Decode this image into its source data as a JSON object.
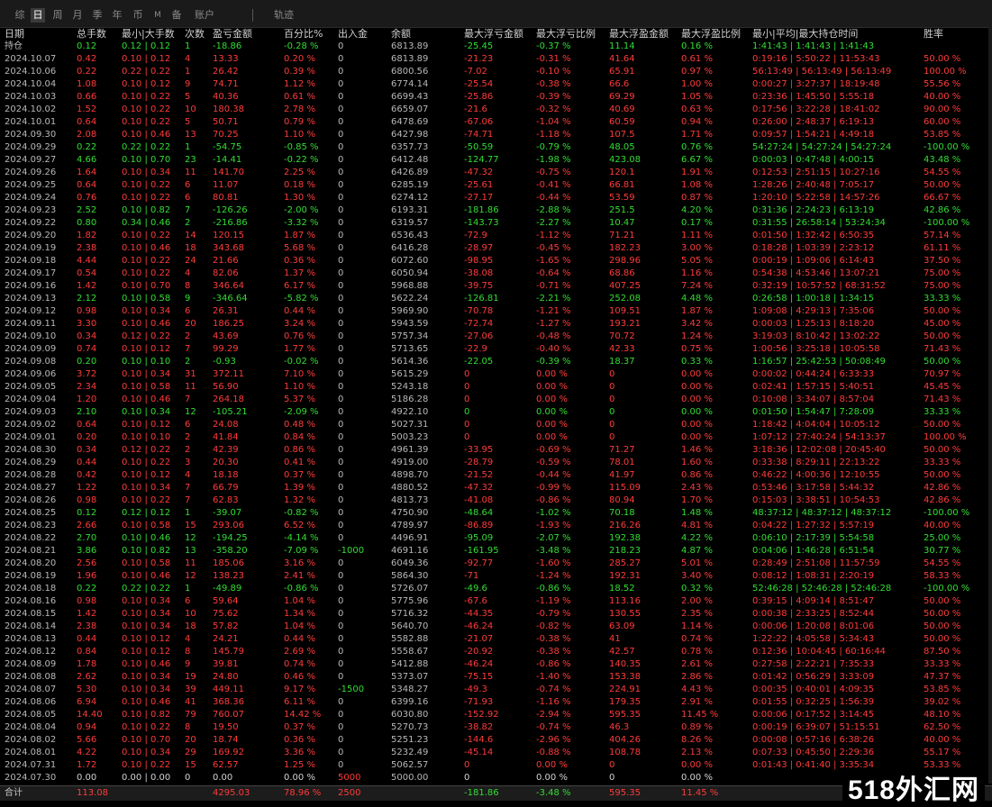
{
  "tabs": [
    {
      "label": "综",
      "active": false,
      "small": false
    },
    {
      "label": "日",
      "active": true,
      "small": false
    },
    {
      "label": "周",
      "active": false,
      "small": false
    },
    {
      "label": "月",
      "active": false,
      "small": false
    },
    {
      "label": "季",
      "active": false,
      "small": false
    },
    {
      "label": "年",
      "active": false,
      "small": false
    },
    {
      "label": "币",
      "active": false,
      "small": false
    },
    {
      "label": "M",
      "active": false,
      "small": true
    },
    {
      "label": "备",
      "active": false,
      "small": false
    },
    {
      "label": "账户",
      "active": false,
      "small": false
    },
    {
      "label": "轨迹",
      "active": false,
      "small": false
    }
  ],
  "columns": [
    "日期",
    "总手数",
    "最小|大手数",
    "次数",
    "盈亏金额",
    "百分比%",
    "出入金",
    "余额",
    "最大浮亏金额",
    "最大浮亏比例",
    "最大浮盈金额",
    "最大浮盈比例",
    "最小|平均|最大持仓时间",
    "胜率"
  ],
  "holding": [
    "持仓",
    "0.12",
    "0.12 | 0.12",
    "1",
    "-18.86",
    "-0.28 %",
    "0",
    "6813.89",
    "-25.45",
    "-0.37 %",
    "11.14",
    "0.16 %",
    "1:41:43 | 1:41:43 | 1:41:43",
    ""
  ],
  "rows": [
    [
      "2024.10.07",
      "0.42",
      "0.10 | 0.12",
      "4",
      "13.33",
      "0.20 %",
      "0",
      "6813.89",
      "-21.23",
      "-0.31 %",
      "41.64",
      "0.61 %",
      "0:19:16 | 5:50:22 | 11:53:43",
      "50.00 %"
    ],
    [
      "2024.10.06",
      "0.22",
      "0.22 | 0.22",
      "1",
      "26.42",
      "0.39 %",
      "0",
      "6800.56",
      "-7.02",
      "-0.10 %",
      "65.91",
      "0.97 %",
      "56:13:49 | 56:13:49 | 56:13:49",
      "100.00 %"
    ],
    [
      "2024.10.04",
      "1.08",
      "0.10 | 0.12",
      "9",
      "74.71",
      "1.12 %",
      "0",
      "6774.14",
      "-25.54",
      "-0.38 %",
      "66.6",
      "1.00 %",
      "0:00:27 | 3:27:37 | 18:19:48",
      "55.56 %"
    ],
    [
      "2024.10.03",
      "0.66",
      "0.10 | 0.22",
      "5",
      "40.36",
      "0.61 %",
      "0",
      "6699.43",
      "-25.86",
      "-0.39 %",
      "69.29",
      "1.05 %",
      "0:23:36 | 1:45:50 | 5:55:18",
      "40.00 %"
    ],
    [
      "2024.10.02",
      "1.52",
      "0.10 | 0.22",
      "10",
      "180.38",
      "2.78 %",
      "0",
      "6659.07",
      "-21.6",
      "-0.32 %",
      "40.69",
      "0.63 %",
      "0:17:56 | 3:22:28 | 18:41:02",
      "90.00 %"
    ],
    [
      "2024.10.01",
      "0.64",
      "0.10 | 0.22",
      "5",
      "50.71",
      "0.79 %",
      "0",
      "6478.69",
      "-67.06",
      "-1.04 %",
      "60.59",
      "0.94 %",
      "0:26:00 | 2:48:37 | 6:19:13",
      "60.00 %"
    ],
    [
      "2024.09.30",
      "2.08",
      "0.10 | 0.46",
      "13",
      "70.25",
      "1.10 %",
      "0",
      "6427.98",
      "-74.71",
      "-1.18 %",
      "107.5",
      "1.71 %",
      "0:09:57 | 1:54:21 | 4:49:18",
      "53.85 %"
    ],
    [
      "2024.09.29",
      "0.22",
      "0.22 | 0.22",
      "1",
      "-54.75",
      "-0.85 %",
      "0",
      "6357.73",
      "-50.59",
      "-0.79 %",
      "48.05",
      "0.76 %",
      "54:27:24 | 54:27:24 | 54:27:24",
      "-100.00 %"
    ],
    [
      "2024.09.27",
      "4.66",
      "0.10 | 0.70",
      "23",
      "-14.41",
      "-0.22 %",
      "0",
      "6412.48",
      "-124.77",
      "-1.98 %",
      "423.08",
      "6.67 %",
      "0:00:03 | 0:47:48 | 4:00:15",
      "43.48 %"
    ],
    [
      "2024.09.26",
      "1.64",
      "0.10 | 0.34",
      "11",
      "141.70",
      "2.25 %",
      "0",
      "6426.89",
      "-47.32",
      "-0.75 %",
      "120.1",
      "1.91 %",
      "0:12:53 | 2:51:15 | 10:27:16",
      "54.55 %"
    ],
    [
      "2024.09.25",
      "0.64",
      "0.10 | 0.22",
      "6",
      "11.07",
      "0.18 %",
      "0",
      "6285.19",
      "-25.61",
      "-0.41 %",
      "66.81",
      "1.08 %",
      "1:28:26 | 2:40:48 | 7:05:17",
      "50.00 %"
    ],
    [
      "2024.09.24",
      "0.76",
      "0.10 | 0.22",
      "6",
      "80.81",
      "1.30 %",
      "0",
      "6274.12",
      "-27.17",
      "-0.44 %",
      "53.59",
      "0.87 %",
      "1:20:10 | 5:22:58 | 14:57:26",
      "66.67 %"
    ],
    [
      "2024.09.23",
      "2.52",
      "0.10 | 0.82",
      "7",
      "-126.26",
      "-2.00 %",
      "0",
      "6193.31",
      "-181.86",
      "-2.88 %",
      "251.5",
      "4.20 %",
      "0:31:36 | 2:24:23 | 6:13:19",
      "42.86 %"
    ],
    [
      "2024.09.22",
      "0.80",
      "0.34 | 0.46",
      "2",
      "-216.86",
      "-3.32 %",
      "0",
      "6319.57",
      "-143.73",
      "-2.27 %",
      "10.47",
      "0.17 %",
      "0:31:55 | 26:58:14 | 53:24:34",
      "-100.00 %"
    ],
    [
      "2024.09.20",
      "1.82",
      "0.10 | 0.22",
      "14",
      "120.15",
      "1.87 %",
      "0",
      "6536.43",
      "-72.9",
      "-1.12 %",
      "71.21",
      "1.11 %",
      "0:01:50 | 1:32:42 | 6:50:35",
      "57.14 %"
    ],
    [
      "2024.09.19",
      "2.38",
      "0.10 | 0.46",
      "18",
      "343.68",
      "5.68 %",
      "0",
      "6416.28",
      "-28.97",
      "-0.45 %",
      "182.23",
      "3.00 %",
      "0:18:28 | 1:03:39 | 2:23:12",
      "61.11 %"
    ],
    [
      "2024.09.18",
      "4.44",
      "0.10 | 0.22",
      "24",
      "21.66",
      "0.36 %",
      "0",
      "6072.60",
      "-98.95",
      "-1.65 %",
      "298.96",
      "5.05 %",
      "0:00:19 | 1:09:06 | 6:14:43",
      "37.50 %"
    ],
    [
      "2024.09.17",
      "0.54",
      "0.10 | 0.22",
      "4",
      "82.06",
      "1.37 %",
      "0",
      "6050.94",
      "-38.08",
      "-0.64 %",
      "68.86",
      "1.16 %",
      "0:54:38 | 4:53:46 | 13:07:21",
      "75.00 %"
    ],
    [
      "2024.09.16",
      "1.42",
      "0.10 | 0.70",
      "8",
      "346.64",
      "6.17 %",
      "0",
      "5968.88",
      "-39.75",
      "-0.71 %",
      "407.25",
      "7.24 %",
      "0:32:19 | 10:57:52 | 68:31:52",
      "75.00 %"
    ],
    [
      "2024.09.13",
      "2.12",
      "0.10 | 0.58",
      "9",
      "-346.64",
      "-5.82 %",
      "0",
      "5622.24",
      "-126.81",
      "-2.21 %",
      "252.08",
      "4.48 %",
      "0:26:58 | 1:00:18 | 1:34:15",
      "33.33 %"
    ],
    [
      "2024.09.12",
      "0.98",
      "0.10 | 0.34",
      "6",
      "26.31",
      "0.44 %",
      "0",
      "5969.90",
      "-70.78",
      "-1.21 %",
      "109.51",
      "1.87 %",
      "1:09:08 | 4:29:13 | 7:35:06",
      "50.00 %"
    ],
    [
      "2024.09.11",
      "3.30",
      "0.10 | 0.46",
      "20",
      "186.25",
      "3.24 %",
      "0",
      "5943.59",
      "-72.74",
      "-1.27 %",
      "193.21",
      "3.42 %",
      "0:00:03 | 1:25:13 | 8:18:20",
      "45.00 %"
    ],
    [
      "2024.09.10",
      "0.34",
      "0.12 | 0.22",
      "2",
      "43.69",
      "0.76 %",
      "0",
      "5757.34",
      "-27.06",
      "-0.48 %",
      "70.72",
      "1.24 %",
      "3:19:03 | 8:10:42 | 13:02:22",
      "50.00 %"
    ],
    [
      "2024.09.09",
      "0.74",
      "0.10 | 0.12",
      "7",
      "99.29",
      "1.77 %",
      "0",
      "5713.65",
      "-22.9",
      "-0.40 %",
      "42.33",
      "0.75 %",
      "1:00:56 | 3:25:18 | 10:05:58",
      "71.43 %"
    ],
    [
      "2024.09.08",
      "0.20",
      "0.10 | 0.10",
      "2",
      "-0.93",
      "-0.02 %",
      "0",
      "5614.36",
      "-22.05",
      "-0.39 %",
      "18.37",
      "0.33 %",
      "1:16:57 | 25:42:53 | 50:08:49",
      "50.00 %"
    ],
    [
      "2024.09.06",
      "3.72",
      "0.10 | 0.34",
      "31",
      "372.11",
      "7.10 %",
      "0",
      "5615.29",
      "0",
      "0.00 %",
      "0",
      "0.00 %",
      "0:00:02 | 0:44:24 | 6:33:33",
      "70.97 %"
    ],
    [
      "2024.09.05",
      "2.34",
      "0.10 | 0.58",
      "11",
      "56.90",
      "1.10 %",
      "0",
      "5243.18",
      "0",
      "0.00 %",
      "0",
      "0.00 %",
      "0:02:41 | 1:57:15 | 5:40:51",
      "45.45 %"
    ],
    [
      "2024.09.04",
      "1.20",
      "0.10 | 0.46",
      "7",
      "264.18",
      "5.37 %",
      "0",
      "5186.28",
      "0",
      "0.00 %",
      "0",
      "0.00 %",
      "0:10:08 | 3:34:07 | 8:57:04",
      "71.43 %"
    ],
    [
      "2024.09.03",
      "2.10",
      "0.10 | 0.34",
      "12",
      "-105.21",
      "-2.09 %",
      "0",
      "4922.10",
      "0",
      "0.00 %",
      "0",
      "0.00 %",
      "0:01:50 | 1:54:47 | 7:28:09",
      "33.33 %"
    ],
    [
      "2024.09.02",
      "0.64",
      "0.10 | 0.12",
      "6",
      "24.08",
      "0.48 %",
      "0",
      "5027.31",
      "0",
      "0.00 %",
      "0",
      "0.00 %",
      "1:18:42 | 4:04:04 | 10:05:12",
      "50.00 %"
    ],
    [
      "2024.09.01",
      "0.20",
      "0.10 | 0.10",
      "2",
      "41.84",
      "0.84 %",
      "0",
      "5003.23",
      "0",
      "0.00 %",
      "0",
      "0.00 %",
      "1:07:12 | 27:40:24 | 54:13:37",
      "100.00 %"
    ],
    [
      "2024.08.30",
      "0.34",
      "0.12 | 0.22",
      "2",
      "42.39",
      "0.86 %",
      "0",
      "4961.39",
      "-33.95",
      "-0.69 %",
      "71.27",
      "1.46 %",
      "3:18:36 | 12:02:08 | 20:45:40",
      "50.00 %"
    ],
    [
      "2024.08.29",
      "0.44",
      "0.10 | 0.22",
      "3",
      "20.30",
      "0.41 %",
      "0",
      "4919.00",
      "-28.79",
      "-0.59 %",
      "78.01",
      "1.60 %",
      "0:33:38 | 8:29:11 | 22:13:22",
      "33.33 %"
    ],
    [
      "2024.08.28",
      "0.42",
      "0.10 | 0.12",
      "4",
      "18.18",
      "0.37 %",
      "0",
      "4898.70",
      "-21.52",
      "-0.44 %",
      "41.97",
      "0.86 %",
      "0:46:22 | 4:00:36 | 12:10:55",
      "50.00 %"
    ],
    [
      "2024.08.27",
      "1.22",
      "0.10 | 0.34",
      "7",
      "66.79",
      "1.39 %",
      "0",
      "4880.52",
      "-47.32",
      "-0.99 %",
      "115.09",
      "2.43 %",
      "0:53:46 | 3:17:58 | 5:44:32",
      "42.86 %"
    ],
    [
      "2024.08.26",
      "0.98",
      "0.10 | 0.22",
      "7",
      "62.83",
      "1.32 %",
      "0",
      "4813.73",
      "-41.08",
      "-0.86 %",
      "80.94",
      "1.70 %",
      "0:15:03 | 3:38:51 | 10:54:53",
      "42.86 %"
    ],
    [
      "2024.08.25",
      "0.12",
      "0.12 | 0.12",
      "1",
      "-39.07",
      "-0.82 %",
      "0",
      "4750.90",
      "-48.64",
      "-1.02 %",
      "70.18",
      "1.48 %",
      "48:37:12 | 48:37:12 | 48:37:12",
      "-100.00 %"
    ],
    [
      "2024.08.23",
      "2.66",
      "0.10 | 0.58",
      "15",
      "293.06",
      "6.52 %",
      "0",
      "4789.97",
      "-86.89",
      "-1.93 %",
      "216.26",
      "4.81 %",
      "0:04:22 | 1:27:32 | 5:57:19",
      "40.00 %"
    ],
    [
      "2024.08.22",
      "2.70",
      "0.10 | 0.46",
      "12",
      "-194.25",
      "-4.14 %",
      "0",
      "4496.91",
      "-95.09",
      "-2.07 %",
      "192.38",
      "4.22 %",
      "0:06:10 | 2:17:39 | 5:54:58",
      "25.00 %"
    ],
    [
      "2024.08.21",
      "3.86",
      "0.10 | 0.82",
      "13",
      "-358.20",
      "-7.09 %",
      "-1000",
      "4691.16",
      "-161.95",
      "-3.48 %",
      "218.23",
      "4.87 %",
      "0:04:06 | 1:46:28 | 6:51:54",
      "30.77 %"
    ],
    [
      "2024.08.20",
      "2.56",
      "0.10 | 0.58",
      "11",
      "185.06",
      "3.16 %",
      "0",
      "6049.36",
      "-92.77",
      "-1.60 %",
      "285.27",
      "5.01 %",
      "0:28:49 | 2:51:08 | 11:57:59",
      "54.55 %"
    ],
    [
      "2024.08.19",
      "1.96",
      "0.10 | 0.46",
      "12",
      "138.23",
      "2.41 %",
      "0",
      "5864.30",
      "-71",
      "-1.24 %",
      "192.31",
      "3.40 %",
      "0:08:12 | 1:08:31 | 2:20:19",
      "58.33 %"
    ],
    [
      "2024.08.18",
      "0.22",
      "0.22 | 0.22",
      "1",
      "-49.89",
      "-0.86 %",
      "0",
      "5726.07",
      "-49.6",
      "-0.86 %",
      "18.52",
      "0.32 %",
      "52:46:28 | 52:46:28 | 52:46:28",
      "-100.00 %"
    ],
    [
      "2024.08.16",
      "0.98",
      "0.10 | 0.34",
      "6",
      "59.64",
      "1.04 %",
      "0",
      "5775.96",
      "-67.6",
      "-1.19 %",
      "113.16",
      "2.00 %",
      "0:39:15 | 4:09:14 | 8:51:47",
      "50.00 %"
    ],
    [
      "2024.08.15",
      "1.42",
      "0.10 | 0.34",
      "10",
      "75.62",
      "1.34 %",
      "0",
      "5716.32",
      "-44.35",
      "-0.79 %",
      "130.55",
      "2.35 %",
      "0:00:38 | 2:33:25 | 8:52:44",
      "50.00 %"
    ],
    [
      "2024.08.14",
      "2.38",
      "0.10 | 0.34",
      "18",
      "57.82",
      "1.04 %",
      "0",
      "5640.70",
      "-46.24",
      "-0.82 %",
      "63.09",
      "1.14 %",
      "0:00:06 | 1:20:08 | 8:01:06",
      "50.00 %"
    ],
    [
      "2024.08.13",
      "0.44",
      "0.10 | 0.12",
      "4",
      "24.21",
      "0.44 %",
      "0",
      "5582.88",
      "-21.07",
      "-0.38 %",
      "41",
      "0.74 %",
      "1:22:22 | 4:05:58 | 5:34:43",
      "50.00 %"
    ],
    [
      "2024.08.12",
      "0.84",
      "0.10 | 0.12",
      "8",
      "145.79",
      "2.69 %",
      "0",
      "5558.67",
      "-20.92",
      "-0.38 %",
      "42.57",
      "0.78 %",
      "0:12:36 | 10:04:45 | 60:16:44",
      "87.50 %"
    ],
    [
      "2024.08.09",
      "1.78",
      "0.10 | 0.46",
      "9",
      "39.81",
      "0.74 %",
      "0",
      "5412.88",
      "-46.24",
      "-0.86 %",
      "140.35",
      "2.61 %",
      "0:27:58 | 2:22:21 | 7:35:33",
      "33.33 %"
    ],
    [
      "2024.08.08",
      "2.62",
      "0.10 | 0.34",
      "19",
      "24.80",
      "0.46 %",
      "0",
      "5373.07",
      "-75.15",
      "-1.40 %",
      "153.38",
      "2.86 %",
      "0:01:42 | 0:56:29 | 3:33:09",
      "47.37 %"
    ],
    [
      "2024.08.07",
      "5.30",
      "0.10 | 0.34",
      "39",
      "449.11",
      "9.17 %",
      "-1500",
      "5348.27",
      "-49.3",
      "-0.74 %",
      "224.91",
      "4.43 %",
      "0:00:35 | 0:40:01 | 4:09:35",
      "53.85 %"
    ],
    [
      "2024.08.06",
      "6.94",
      "0.10 | 0.46",
      "41",
      "368.36",
      "6.11 %",
      "0",
      "6399.16",
      "-71.93",
      "-1.16 %",
      "179.35",
      "2.91 %",
      "0:01:55 | 0:32:25 | 1:56:39",
      "39.02 %"
    ],
    [
      "2024.08.05",
      "14.40",
      "0.10 | 0.82",
      "79",
      "760.07",
      "14.42 %",
      "0",
      "6030.80",
      "-152.92",
      "-2.94 %",
      "595.35",
      "11.45 %",
      "0:00:06 | 0:17:52 | 3:14:45",
      "48.10 %"
    ],
    [
      "2024.08.04",
      "0.94",
      "0.10 | 0.22",
      "8",
      "19.50",
      "0.37 %",
      "0",
      "5270.73",
      "-38.82",
      "-0.74 %",
      "46.3",
      "0.89 %",
      "0:00:19 | 6:39:07 | 51:15:51",
      "62.50 %"
    ],
    [
      "2024.08.02",
      "5.66",
      "0.10 | 0.70",
      "20",
      "18.74",
      "0.36 %",
      "0",
      "5251.23",
      "-144.6",
      "-2.96 %",
      "404.26",
      "8.26 %",
      "0:00:08 | 0:57:16 | 6:38:26",
      "40.00 %"
    ],
    [
      "2024.08.01",
      "4.22",
      "0.10 | 0.34",
      "29",
      "169.92",
      "3.36 %",
      "0",
      "5232.49",
      "-45.14",
      "-0.88 %",
      "108.78",
      "2.13 %",
      "0:07:33 | 0:45:50 | 2:29:36",
      "55.17 %"
    ],
    [
      "2024.07.31",
      "1.72",
      "0.10 | 0.22",
      "15",
      "62.57",
      "1.25 %",
      "0",
      "5062.57",
      "0",
      "0.00 %",
      "0",
      "0.00 %",
      "0:01:43 | 0:41:40 | 3:35:34",
      "53.33 %"
    ],
    [
      "2024.07.30",
      "0.00",
      "0.00 | 0.00",
      "0",
      "0.00",
      "0.00 %",
      "5000",
      "5000.00",
      "0",
      "0.00 %",
      "0",
      "0.00 %",
      "",
      ""
    ]
  ],
  "total": [
    "合计",
    "113.08",
    "",
    "",
    "4295.03",
    "78.96 %",
    "2500",
    "",
    "-181.86",
    "-3.48 %",
    "595.35",
    "11.45 %",
    "",
    ""
  ],
  "watermark": "518外汇网",
  "colors": {
    "profit": "#ff3b3b",
    "loss": "#33dd33",
    "neutral": "#c8c8c8",
    "background": "#000000"
  }
}
